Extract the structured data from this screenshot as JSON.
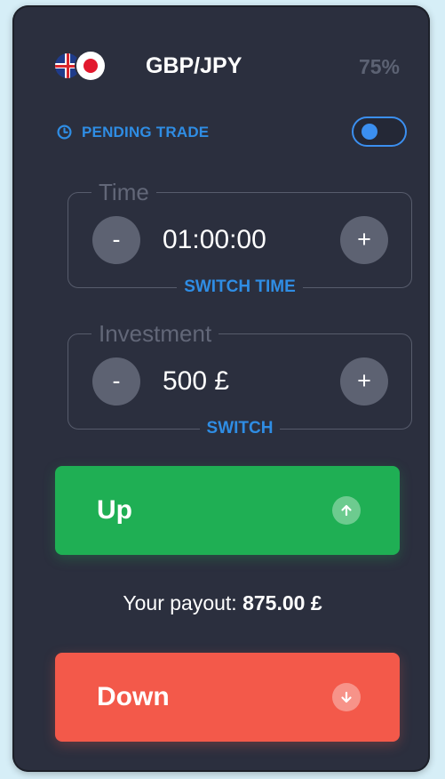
{
  "asset": {
    "pair": "GBP/JPY",
    "payout_percent": "75%",
    "flag_left": "uk-flag-icon",
    "flag_right": "japan-flag-icon"
  },
  "pending": {
    "label": "PENDING TRADE",
    "icon": "clock-icon",
    "toggle_on": true
  },
  "time": {
    "legend": "Time",
    "value": "01:00:00",
    "minus_label": "-",
    "plus_label": "+",
    "switch_label": "SWITCH TIME"
  },
  "investment": {
    "legend": "Investment",
    "value": "500 £",
    "minus_label": "-",
    "plus_label": "+",
    "switch_label": "SWITCH"
  },
  "up": {
    "label": "Up",
    "icon": "arrow-up-icon",
    "color": "#1faf54"
  },
  "payout": {
    "prefix": "Your payout:",
    "amount": "875.00 £"
  },
  "down": {
    "label": "Down",
    "icon": "arrow-down-icon",
    "color": "#f3594a"
  },
  "colors": {
    "accent": "#2f8de4",
    "panel": "#2b2f3e",
    "background": "#d6eef7"
  }
}
